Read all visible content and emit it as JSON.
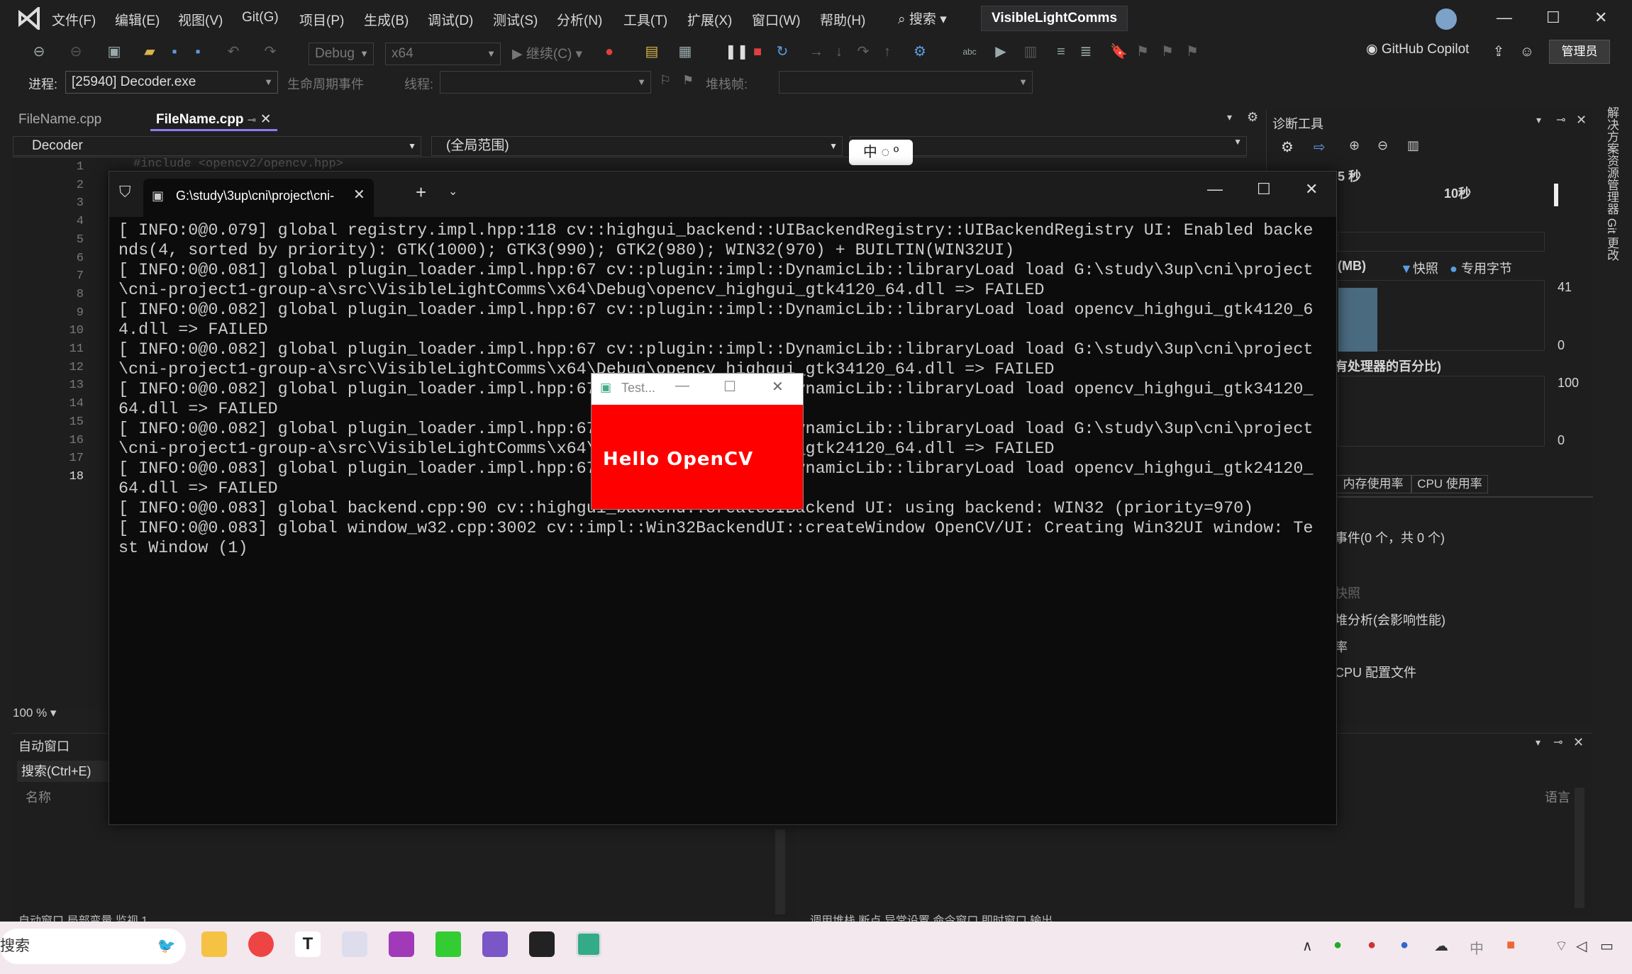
{
  "menu": [
    "文件(F)",
    "编辑(E)",
    "视图(V)",
    "Git(G)",
    "项目(P)",
    "生成(B)",
    "调试(D)",
    "测试(S)",
    "分析(N)",
    "工具(T)",
    "扩展(X)",
    "窗口(W)",
    "帮助(H)"
  ],
  "search_label": "搜索",
  "solution_name": "VisibleLightComms",
  "toolbar": {
    "config": "Debug",
    "platform": "x64",
    "continue_label": "继续(C)",
    "copilot_label": "GitHub Copilot",
    "admin_label": "管理员"
  },
  "debug_row": {
    "process_label": "进程:",
    "process_value": "[25940] Decoder.exe",
    "lifecycle_label": "生命周期事件",
    "thread_label": "线程:",
    "stackframe_label": "堆栈帧:"
  },
  "editor": {
    "tabs": [
      "FileName.cpp",
      "FileName.cpp"
    ],
    "project_combo": "Decoder",
    "scope_combo": "(全局范围)",
    "first_line": "#include <opencv2/opencv.hpp>",
    "line_numbers": [
      "1",
      "2",
      "3",
      "4",
      "5",
      "6",
      "7",
      "8",
      "9",
      "10",
      "11",
      "12",
      "13",
      "14",
      "15",
      "16",
      "17",
      "18"
    ],
    "zoom": "100 %"
  },
  "ime": "中 ◌ º",
  "terminal": {
    "tab_title": "G:\\study\\3up\\cni\\project\\cni-",
    "lines": [
      "[ INFO:0@0.079] global registry.impl.hpp:118 cv::highgui_backend::UIBackendRegistry::UIBackendRegistry UI: Enabled backe",
      "nds(4, sorted by priority): GTK(1000); GTK3(990); GTK2(980); WIN32(970) + BUILTIN(WIN32UI)",
      "[ INFO:0@0.081] global plugin_loader.impl.hpp:67 cv::plugin::impl::DynamicLib::libraryLoad load G:\\study\\3up\\cni\\project",
      "\\cni-project1-group-a\\src\\VisibleLightComms\\x64\\Debug\\opencv_highgui_gtk4120_64.dll => FAILED",
      "[ INFO:0@0.082] global plugin_loader.impl.hpp:67 cv::plugin::impl::DynamicLib::libraryLoad load opencv_highgui_gtk4120_6",
      "4.dll => FAILED",
      "[ INFO:0@0.082] global plugin_loader.impl.hpp:67 cv::plugin::impl::DynamicLib::libraryLoad load G:\\study\\3up\\cni\\project",
      "\\cni-project1-group-a\\src\\VisibleLightComms\\x64\\Debug\\opencv_highgui_gtk34120_64.dll => FAILED",
      "[ INFO:0@0.082] global plugin_loader.impl.hpp:67 cv::plugin::impl::DynamicLib::libraryLoad load opencv_highgui_gtk34120_",
      "64.dll => FAILED",
      "[ INFO:0@0.082] global plugin_loader.impl.hpp:67 cv::plugin::impl::DynamicLib::libraryLoad load G:\\study\\3up\\cni\\project",
      "\\cni-project1-group-a\\src\\VisibleLightComms\\x64\\Debug\\opencv_highgui_gtk24120_64.dll => FAILED",
      "[ INFO:0@0.083] global plugin_loader.impl.hpp:67 cv::plugin::impl::DynamicLib::libraryLoad load opencv_highgui_gtk24120_",
      "64.dll => FAILED",
      "[ INFO:0@0.083] global backend.cpp:90 cv::highgui_backend::createUIBackend UI: using backend: WIN32 (priority=970)",
      "[ INFO:0@0.083] global window_w32.cpp:3002 cv::impl::Win32BackendUI::createWindow OpenCV/UI: Creating Win32UI window: Te",
      "st Window (1)"
    ]
  },
  "cv_window": {
    "title": "Test...",
    "text": "Hello OpenCV",
    "bg_color": "#ff0000"
  },
  "diagnostics": {
    "title": "诊断工具",
    "seconds": "5 秒",
    "ten_sec": "10秒",
    "mem_label": "(MB)",
    "snapshot_legend": "快照",
    "private_legend": "专用字节",
    "mem_max": "41",
    "mem_min": "0",
    "cpu_title": "有处理器的百分比)",
    "cpu_max": "100",
    "cpu_min": "0",
    "tabs": [
      "内存使用率",
      "CPU 使用率"
    ],
    "events": "事件(0 个，共 0 个)",
    "snapshot": "快照",
    "heap_analysis": "堆分析(会影响性能)",
    "rate": "率",
    "cpu_profile": "CPU 配置文件"
  },
  "lower_left": {
    "title": "自动窗口",
    "search": "搜索(Ctrl+E)",
    "col_name": "名称",
    "bottom_tabs": "自动窗口   局部变量   监视 1"
  },
  "lower_right": {
    "col_lang": "语言",
    "bottom_tabs": "调用堆栈   断点   异常设置   命令窗口   即时窗口   输出"
  },
  "right_strip": "解决方案资源管理器   Git 更改",
  "taskbar": {
    "search": "搜索",
    "tray_ime": "中"
  }
}
